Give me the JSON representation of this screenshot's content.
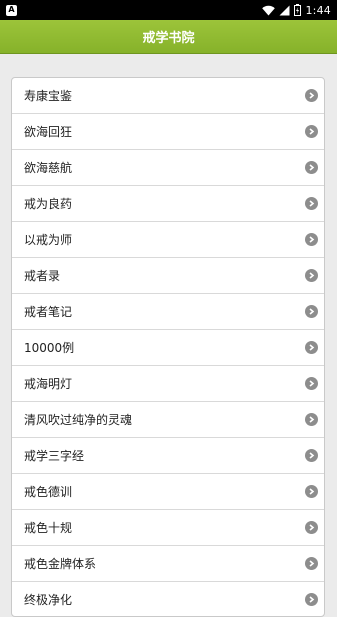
{
  "status_bar": {
    "app_icon_glyph": "A",
    "time": "1:44",
    "icons": [
      "wifi-icon",
      "signal-icon",
      "battery-icon"
    ]
  },
  "header": {
    "title": "戒学书院"
  },
  "menu": {
    "items": [
      {
        "label": "寿康宝鉴"
      },
      {
        "label": "欲海回狂"
      },
      {
        "label": "欲海慈航"
      },
      {
        "label": "戒为良药"
      },
      {
        "label": "以戒为师"
      },
      {
        "label": "戒者录"
      },
      {
        "label": "戒者笔记"
      },
      {
        "label": "10000例"
      },
      {
        "label": "戒海明灯"
      },
      {
        "label": "清风吹过纯净的灵魂"
      },
      {
        "label": "戒学三字经"
      },
      {
        "label": "戒色德训"
      },
      {
        "label": "戒色十规"
      },
      {
        "label": "戒色金牌体系"
      },
      {
        "label": "终极净化"
      }
    ]
  },
  "colors": {
    "header_green": "#8fba30",
    "page_bg": "#ebebeb",
    "chevron_gray": "#8d8d8d"
  }
}
